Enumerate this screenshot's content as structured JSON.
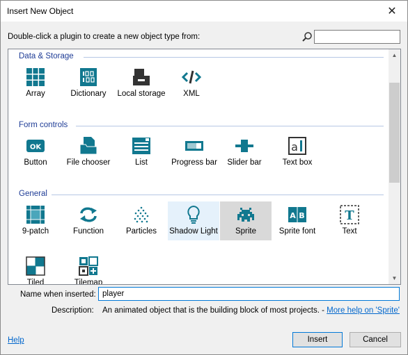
{
  "window": {
    "title": "Insert New Object",
    "close_glyph": "✕"
  },
  "hint": "Double-click a plugin to create a new object type from:",
  "search": {
    "value": "",
    "icon": "magnifier-icon"
  },
  "groups": [
    {
      "title": "Data & Storage",
      "items": [
        {
          "label": "Array",
          "icon": "array-icon"
        },
        {
          "label": "Dictionary",
          "icon": "dictionary-icon"
        },
        {
          "label": "Local storage",
          "icon": "local-storage-icon"
        },
        {
          "label": "XML",
          "icon": "xml-icon"
        }
      ]
    },
    {
      "title": "Form controls",
      "items": [
        {
          "label": "Button",
          "icon": "button-icon"
        },
        {
          "label": "File chooser",
          "icon": "file-chooser-icon"
        },
        {
          "label": "List",
          "icon": "list-icon"
        },
        {
          "label": "Progress bar",
          "icon": "progress-bar-icon"
        },
        {
          "label": "Slider bar",
          "icon": "slider-bar-icon"
        },
        {
          "label": "Text box",
          "icon": "text-box-icon"
        }
      ]
    },
    {
      "title": "General",
      "items": [
        {
          "label": "9-patch",
          "icon": "nine-patch-icon"
        },
        {
          "label": "Function",
          "icon": "function-icon"
        },
        {
          "label": "Particles",
          "icon": "particles-icon"
        },
        {
          "label": "Shadow Light",
          "icon": "shadow-light-icon",
          "state": "hover"
        },
        {
          "label": "Sprite",
          "icon": "sprite-icon",
          "state": "selected"
        },
        {
          "label": "Sprite font",
          "icon": "sprite-font-icon"
        },
        {
          "label": "Text",
          "icon": "text-icon"
        },
        {
          "label": "Tiled",
          "icon": "tiled-background-icon"
        },
        {
          "label": "Tilemap",
          "icon": "tilemap-icon"
        }
      ]
    }
  ],
  "form": {
    "name_label": "Name when inserted:",
    "name_value": "player",
    "description_label": "Description:",
    "description_text": "An animated object that is the building block of most projects. - ",
    "more_help": "More help on 'Sprite'"
  },
  "footer": {
    "help": "Help",
    "insert": "Insert",
    "cancel": "Cancel"
  },
  "colors": {
    "accent": "#0078d7",
    "icon_teal": "#11788f",
    "group_title": "#1e3c96"
  }
}
